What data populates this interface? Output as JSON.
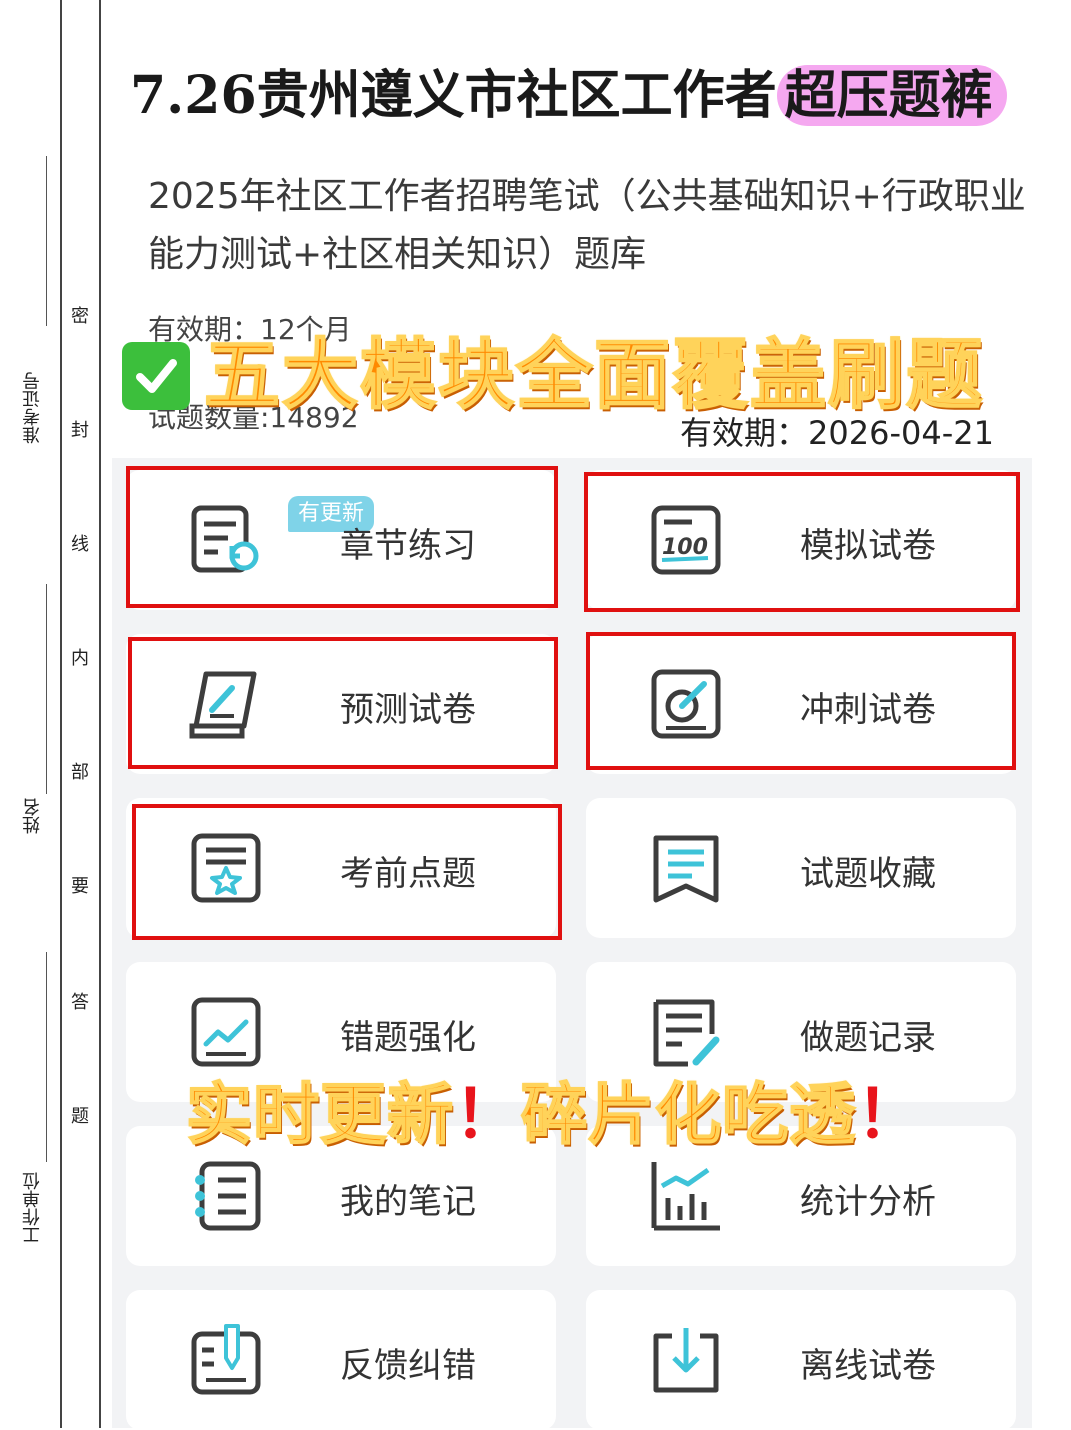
{
  "title": {
    "main": "7.26贵州遵义市社区工作者",
    "highlight": "超压题裤"
  },
  "product": {
    "name": "2025年社区工作者招聘笔试（公共基础知识+行政职业能力测试+社区相关知识）题库",
    "validity": "有效期：12个月",
    "question_count": "试题数量:14892",
    "expire_date": "有效期：2026-04-21"
  },
  "banner_top": "五大模块全面覆盖刷题",
  "banner_bottom": {
    "part1": "实时更新",
    "bang1": "！",
    "part2": "碎片化吃透",
    "bang2": "！"
  },
  "side_margin": {
    "chars": [
      "密",
      "封",
      "线",
      "内",
      "部",
      "要",
      "答",
      "题"
    ],
    "labels": [
      "准考证号",
      "姓名",
      "工作单位"
    ]
  },
  "modules": [
    {
      "label": "章节练习",
      "icon": "list-refresh-icon",
      "badge": "有更新",
      "highlighted": true
    },
    {
      "label": "模拟试卷",
      "icon": "score-100-icon",
      "highlighted": true
    },
    {
      "label": "预测试卷",
      "icon": "scroll-pen-icon",
      "highlighted": true
    },
    {
      "label": "冲刺试卷",
      "icon": "target-pen-icon",
      "highlighted": true
    },
    {
      "label": "考前点题",
      "icon": "star-document-icon",
      "highlighted": true
    },
    {
      "label": "试题收藏",
      "icon": "bookmark-icon",
      "highlighted": false
    },
    {
      "label": "错题强化",
      "icon": "trend-chart-icon",
      "highlighted": false
    },
    {
      "label": "做题记录",
      "icon": "record-pen-icon",
      "highlighted": false
    },
    {
      "label": "我的笔记",
      "icon": "notebook-icon",
      "highlighted": false
    },
    {
      "label": "统计分析",
      "icon": "bar-chart-icon",
      "highlighted": false
    },
    {
      "label": "反馈纠错",
      "icon": "feedback-pen-icon",
      "highlighted": false
    },
    {
      "label": "离线试卷",
      "icon": "download-icon",
      "highlighted": false
    }
  ],
  "colors": {
    "accent": "#3ec3d8",
    "icon_dark": "#3d3d3d",
    "highlight_box": "#e01010",
    "title_highlight": "#f5a8f0",
    "banner": "#ff8a00"
  }
}
